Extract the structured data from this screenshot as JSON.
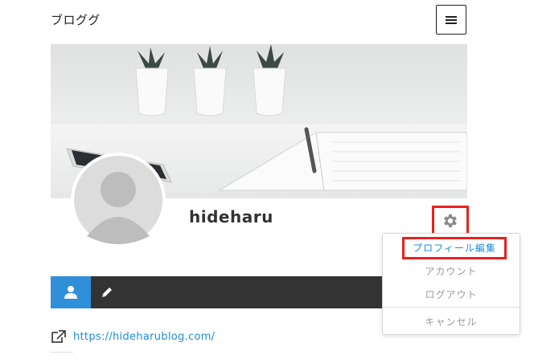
{
  "site": {
    "title": "ブロググ"
  },
  "profile": {
    "name": "hideharu",
    "website": "https://hideharublog.com/"
  },
  "settings_menu": {
    "items": [
      {
        "label": "プロフィール編集",
        "highlighted": true
      },
      {
        "label": "アカウント"
      },
      {
        "label": "ログアウト"
      },
      {
        "label": "キャンセル"
      }
    ]
  },
  "tabs": [
    {
      "icon": "user-icon",
      "active": true
    },
    {
      "icon": "pencil-icon",
      "active": false
    }
  ],
  "colors": {
    "accent": "#2f8fd8",
    "link": "#1e8cd6",
    "highlight_border": "#e8221e",
    "tabbar_bg": "#333333"
  }
}
